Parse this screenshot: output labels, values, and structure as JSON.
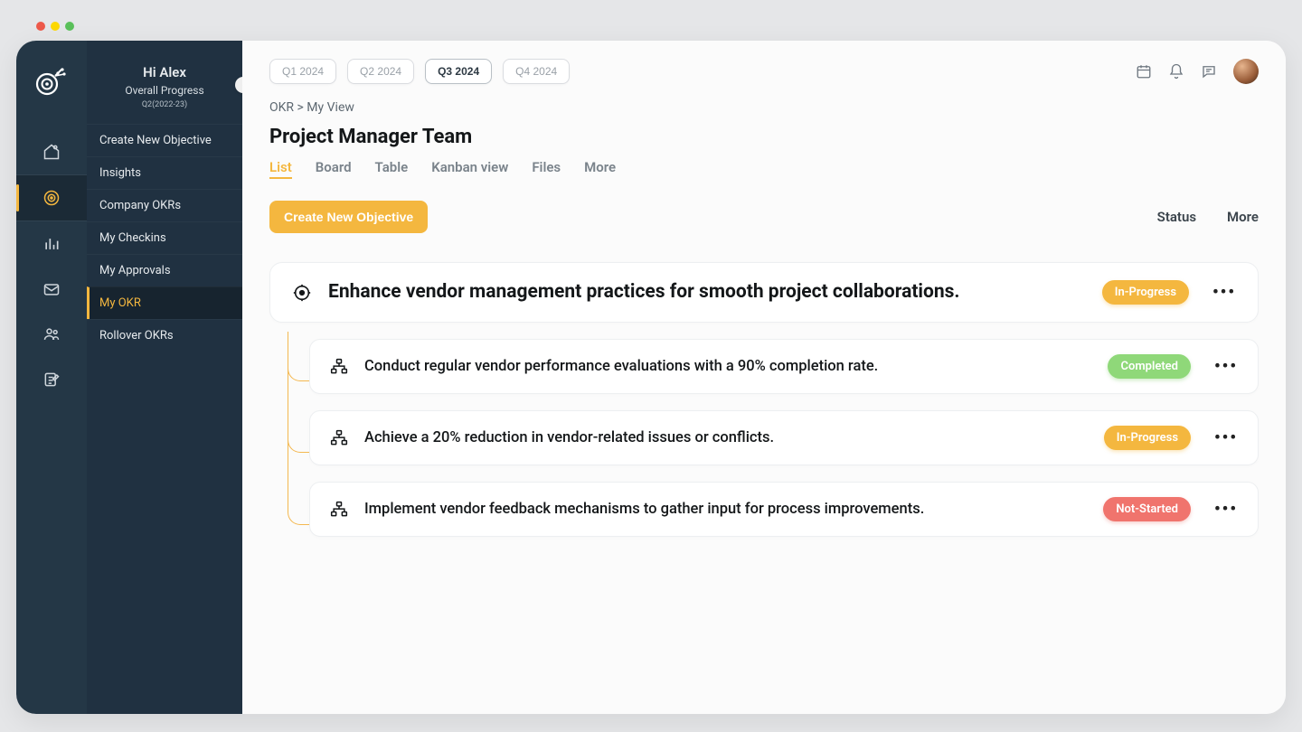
{
  "sidebar": {
    "greeting": "Hi Alex",
    "sub": "Overall Progress",
    "period": "Q2(2022-23)",
    "items": [
      {
        "label": "Create New Objective"
      },
      {
        "label": "Insights"
      },
      {
        "label": "Company OKRs"
      },
      {
        "label": "My  Checkins"
      },
      {
        "label": "My Approvals"
      },
      {
        "label": "My OKR"
      },
      {
        "label": "Rollover OKRs"
      }
    ]
  },
  "quarters": [
    "Q1 2024",
    "Q2 2024",
    "Q3 2024",
    "Q4 2024"
  ],
  "breadcrumb": "OKR > My View",
  "page_title": "Project Manager Team",
  "view_tabs": [
    "List",
    "Board",
    "Table",
    "Kanban view",
    "Files",
    "More"
  ],
  "create_button": "Create New Objective",
  "filters": {
    "status": "Status",
    "more": "More"
  },
  "objective": {
    "title": "Enhance vendor management practices for smooth project collaborations.",
    "status": "In-Progress",
    "key_results": [
      {
        "title": "Conduct regular vendor performance evaluations with a 90% completion rate.",
        "status": "Completed"
      },
      {
        "title": "Achieve a 20% reduction in vendor-related issues or conflicts.",
        "status": "In-Progress"
      },
      {
        "title": "Implement vendor feedback mechanisms to gather input for process improvements.",
        "status": "Not-Started"
      }
    ]
  },
  "status_styles": {
    "In-Progress": "progress",
    "Completed": "completed",
    "Not-Started": "notstarted"
  }
}
